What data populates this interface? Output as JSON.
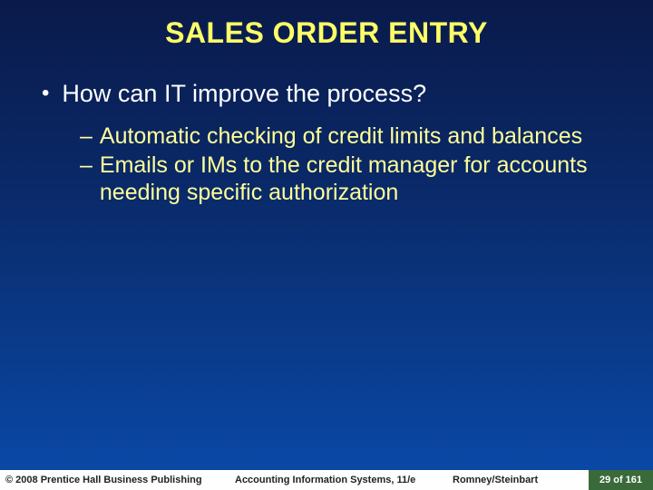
{
  "title": "SALES ORDER ENTRY",
  "bullets": {
    "l1": "How can IT improve the process?",
    "l2a": "Automatic checking of credit limits and balances",
    "l2b": "Emails or IMs to the credit manager for accounts needing specific authorization"
  },
  "footer": {
    "copyright": "© 2008 Prentice Hall Business Publishing",
    "book": "Accounting Information Systems, 11/e",
    "authors": "Romney/Steinbart",
    "page": "29 of 161"
  }
}
